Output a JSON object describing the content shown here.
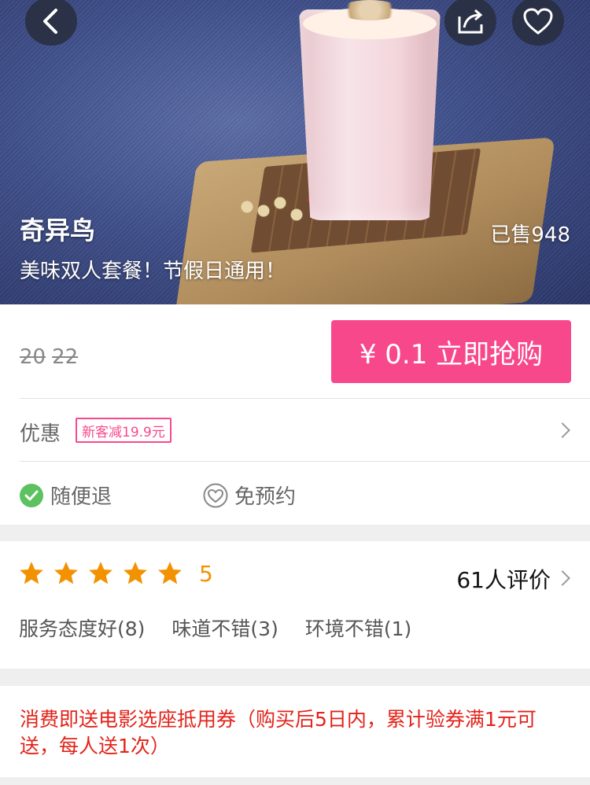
{
  "hero": {
    "title": "奇异鸟",
    "subtitle": "美味双人套餐！节假日通用！",
    "sold": "已售948"
  },
  "price": {
    "original_prices": [
      "20",
      "22"
    ],
    "buy_label": "¥ 0.1  立即抢购"
  },
  "discount": {
    "label": "优惠",
    "badge": "新客减19.9元"
  },
  "guarantees": [
    {
      "label": "随便退",
      "icon": "check-circle-icon"
    },
    {
      "label": "免预约",
      "icon": "heart-circle-icon"
    }
  ],
  "rating": {
    "stars": 5,
    "score": "5",
    "review_count": "61人评价",
    "tags": [
      "服务态度好(8)",
      "味道不错(3)",
      "环境不错(1)"
    ]
  },
  "promo": {
    "text": "消费即送电影选座抵用券（购买后5日内，累计验券满1元可送，每人送1次）"
  },
  "colors": {
    "accent": "#f8488c",
    "star": "#f39200",
    "promo": "#e2231a"
  }
}
